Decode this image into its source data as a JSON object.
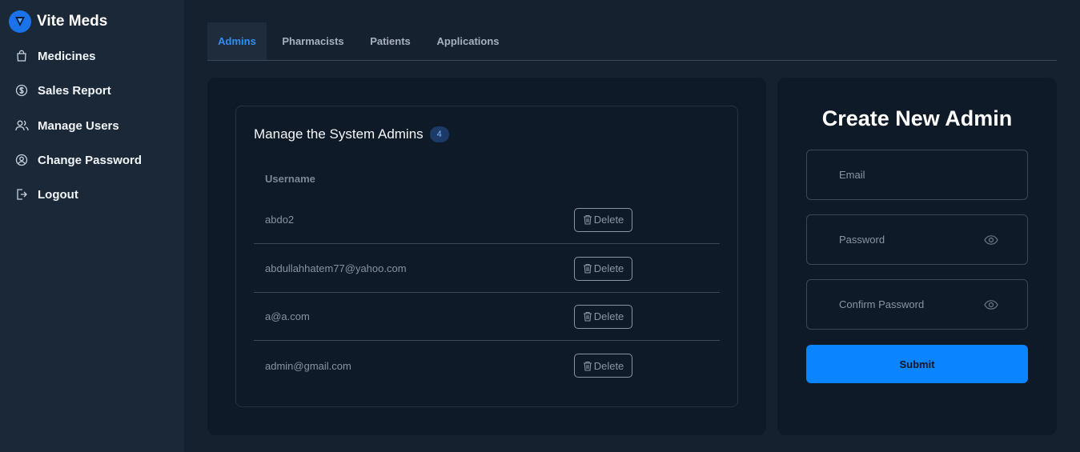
{
  "brand": {
    "name": "Vite Meds",
    "logo_icon": "vite-logo-icon"
  },
  "sidebar": {
    "items": [
      {
        "label": "Medicines",
        "icon": "shopping-bag-icon"
      },
      {
        "label": "Sales Report",
        "icon": "dollar-circle-icon"
      },
      {
        "label": "Manage Users",
        "icon": "users-icon"
      },
      {
        "label": "Change Password",
        "icon": "user-circle-icon"
      },
      {
        "label": "Logout",
        "icon": "logout-icon"
      }
    ]
  },
  "tabs": [
    {
      "label": "Admins",
      "active": true
    },
    {
      "label": "Pharmacists",
      "active": false
    },
    {
      "label": "Patients",
      "active": false
    },
    {
      "label": "Applications",
      "active": false
    }
  ],
  "admins_panel": {
    "title": "Manage the System Admins",
    "count": "4",
    "column_header": "Username",
    "delete_label": "Delete",
    "rows": [
      {
        "username": "abdo2"
      },
      {
        "username": "abdullahhatem77@yahoo.com"
      },
      {
        "username": "a@a.com"
      },
      {
        "username": "admin@gmail.com"
      }
    ]
  },
  "create_form": {
    "title": "Create New Admin",
    "email_placeholder": "Email",
    "password_placeholder": "Password",
    "confirm_placeholder": "Confirm Password",
    "submit_label": "Submit"
  },
  "colors": {
    "accent": "#0a84ff",
    "active_tab": "#2f8ef5",
    "background": "#16212f",
    "card": "#0f1a28",
    "sidebar": "#1b2838"
  }
}
